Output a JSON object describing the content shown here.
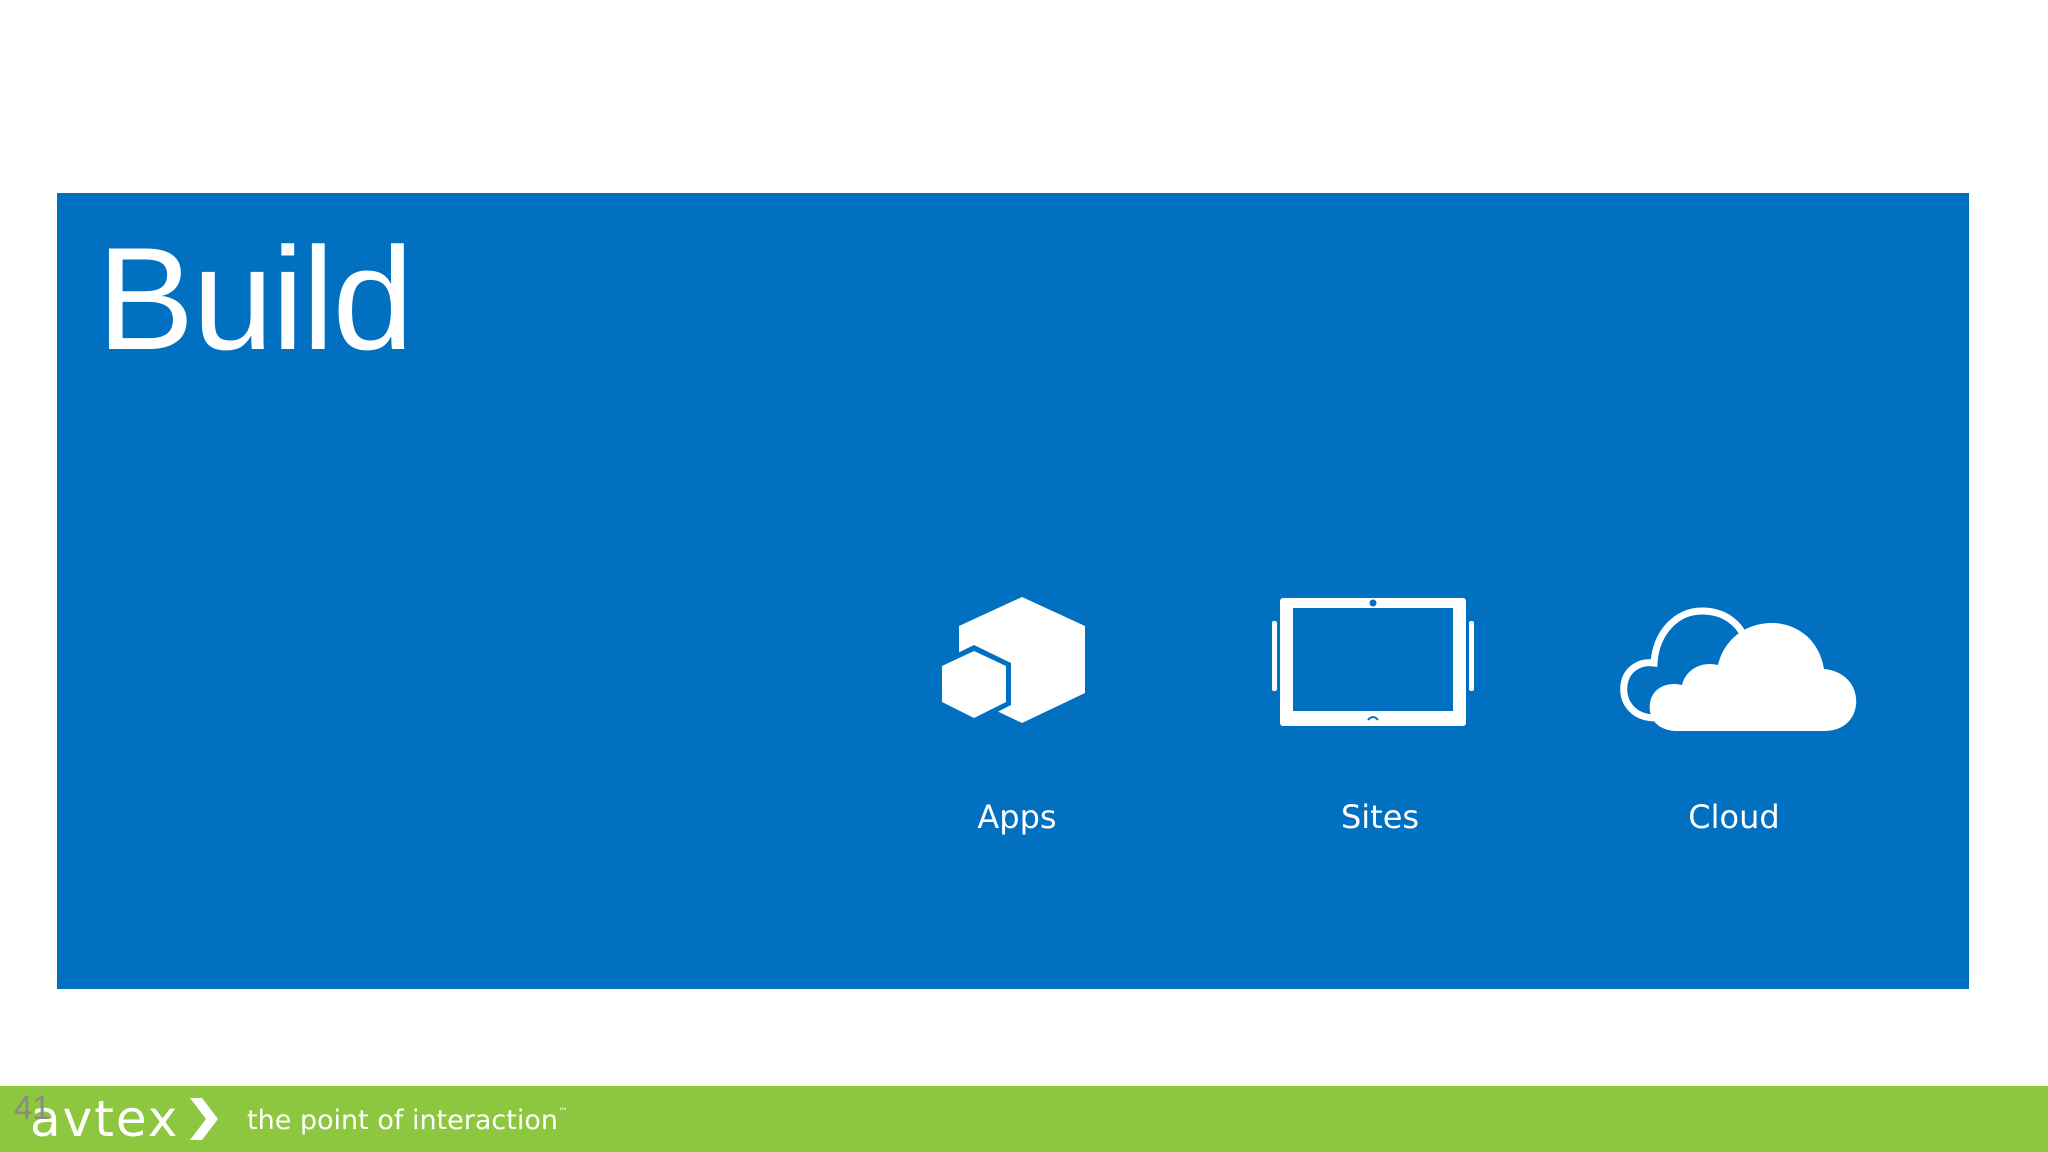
{
  "slide": {
    "title": "Build",
    "page_number": "41"
  },
  "tiles": [
    {
      "label": "Apps",
      "icon": "hexagon-apps-icon"
    },
    {
      "label": "Sites",
      "icon": "tablet-icon"
    },
    {
      "label": "Cloud",
      "icon": "cloud-icon"
    }
  ],
  "footer": {
    "logo_text": "avtex",
    "tagline": "the point of interaction",
    "trademark": "™"
  },
  "colors": {
    "panel": "#0170c0",
    "footer": "#8dc63f",
    "text": "#ffffff"
  }
}
